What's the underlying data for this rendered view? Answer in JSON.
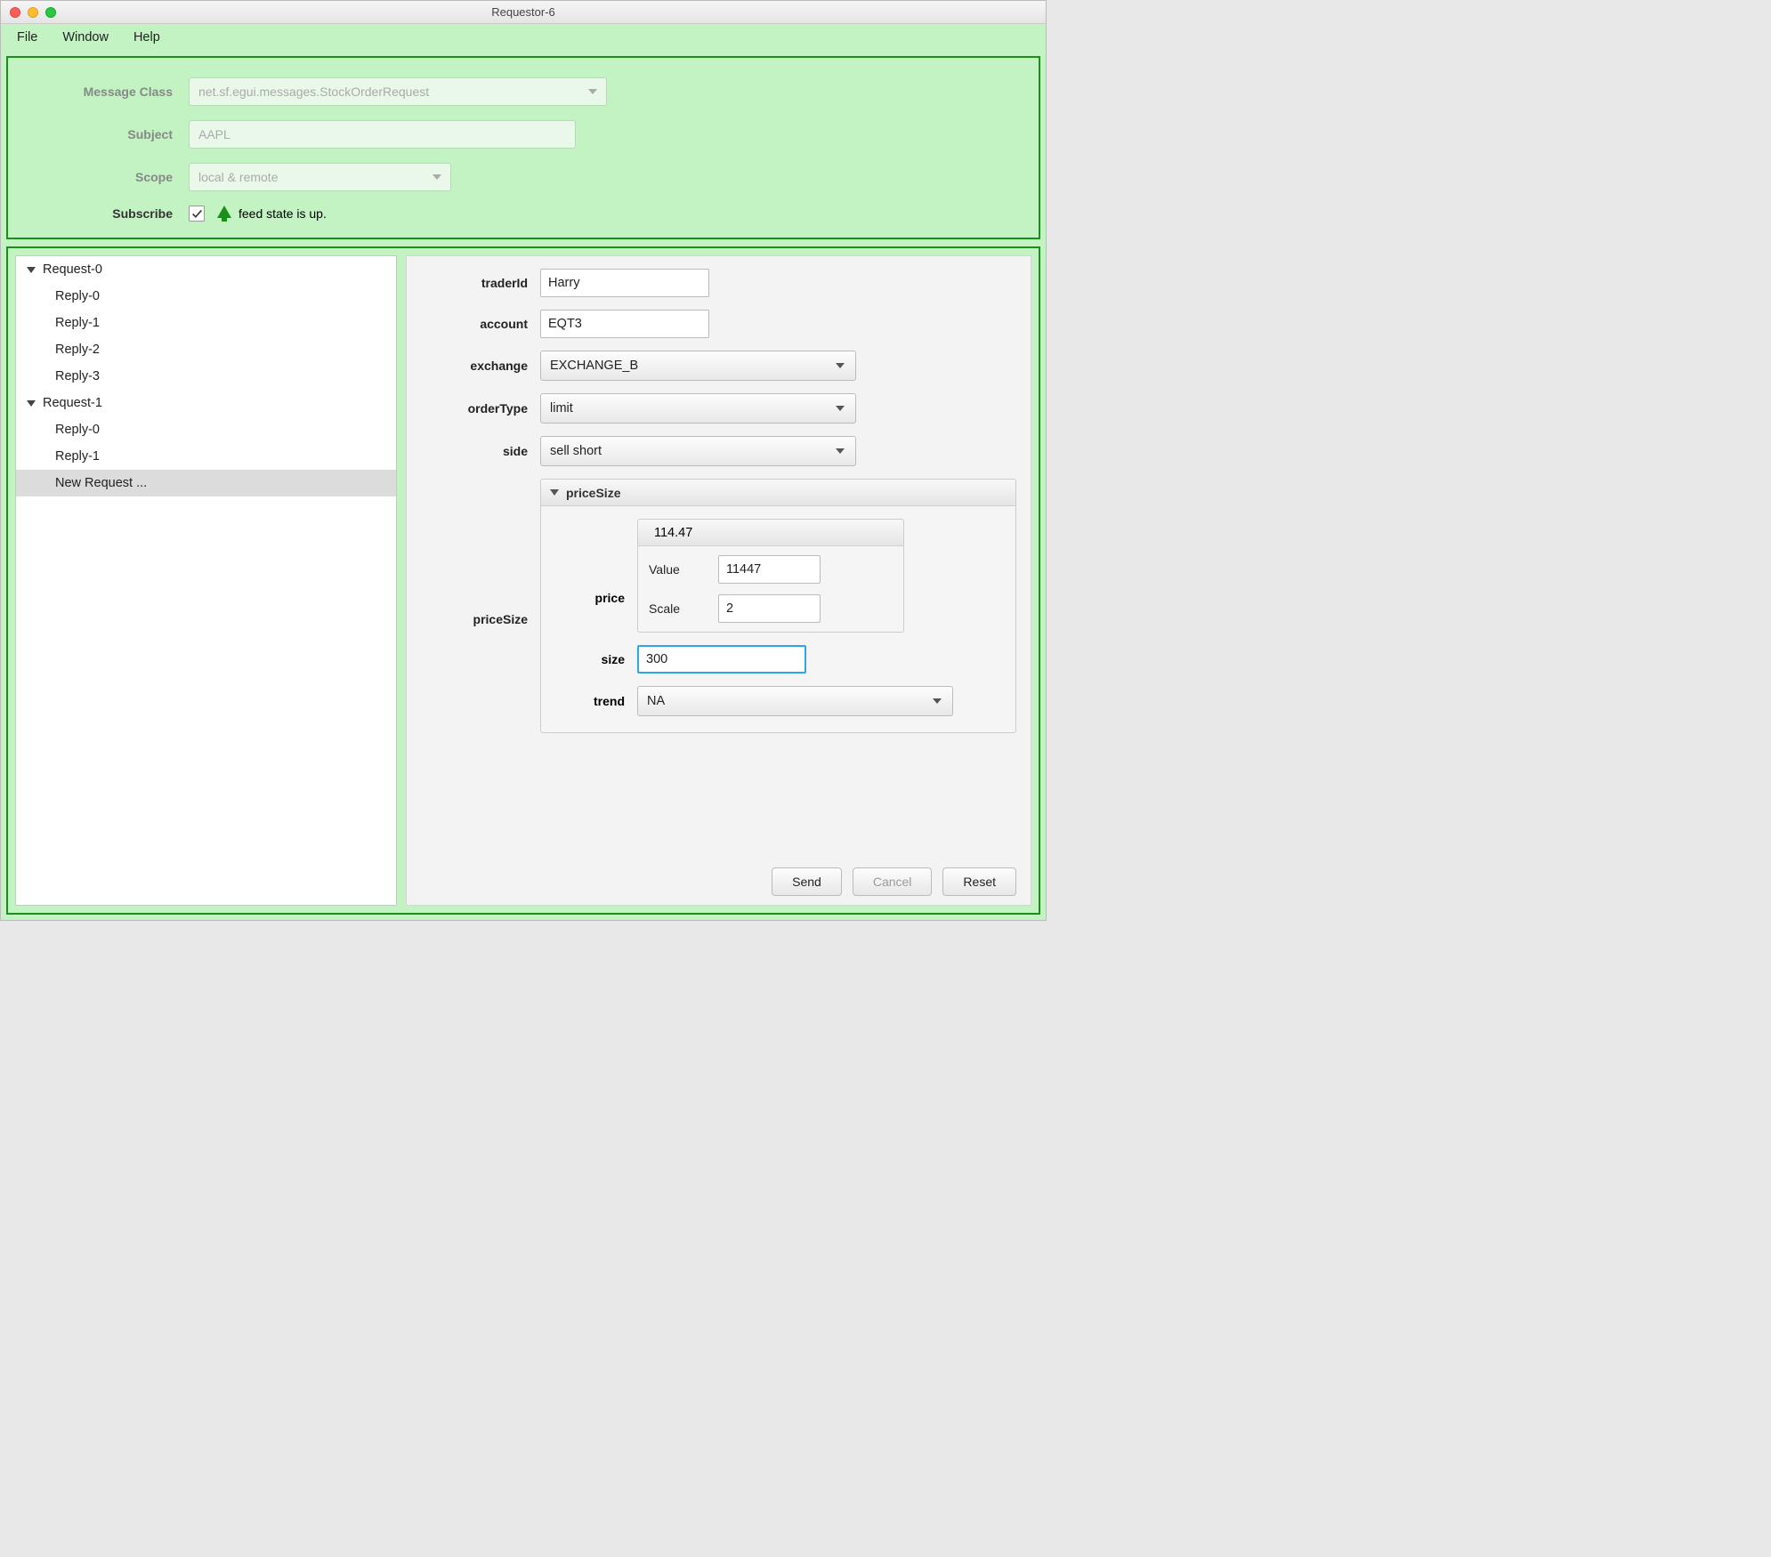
{
  "window": {
    "title": "Requestor-6"
  },
  "menu": {
    "file": "File",
    "window": "Window",
    "help": "Help"
  },
  "top": {
    "messageClass_label": "Message Class",
    "messageClass_value": "net.sf.egui.messages.StockOrderRequest",
    "subject_label": "Subject",
    "subject_value": "AAPL",
    "scope_label": "Scope",
    "scope_value": "local & remote",
    "subscribe_label": "Subscribe",
    "feed_state": "feed state is up."
  },
  "tree": {
    "req0": "Request-0",
    "req0_r0": "Reply-0",
    "req0_r1": "Reply-1",
    "req0_r2": "Reply-2",
    "req0_r3": "Reply-3",
    "req1": "Request-1",
    "req1_r0": "Reply-0",
    "req1_r1": "Reply-1",
    "newreq": "New Request ..."
  },
  "order": {
    "traderId_label": "traderId",
    "traderId_value": "Harry",
    "account_label": "account",
    "account_value": "EQT3",
    "exchange_label": "exchange",
    "exchange_value": "EXCHANGE_B",
    "orderType_label": "orderType",
    "orderType_value": "limit",
    "side_label": "side",
    "side_value": "sell short",
    "priceSize_label": "priceSize",
    "priceSize_header": "priceSize",
    "price_label": "price",
    "price_header": "114.47",
    "value_label": "Value",
    "value_value": "11447",
    "scale_label": "Scale",
    "scale_value": "2",
    "size_label": "size",
    "size_value": "300",
    "trend_label": "trend",
    "trend_value": "NA"
  },
  "buttons": {
    "send": "Send",
    "cancel": "Cancel",
    "reset": "Reset"
  }
}
